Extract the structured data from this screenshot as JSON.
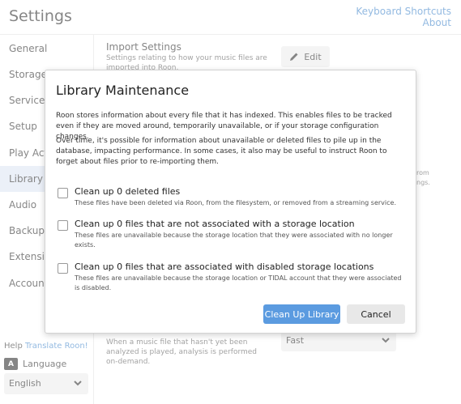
{
  "header": {
    "title": "Settings",
    "keyboard_shortcuts_label": "Keyboard Shortcuts",
    "about_label": "About"
  },
  "sidebar": {
    "items": [
      {
        "label": "General"
      },
      {
        "label": "Storage"
      },
      {
        "label": "Services"
      },
      {
        "label": "Setup"
      },
      {
        "label": "Play Actions"
      },
      {
        "label": "Library",
        "active": true
      },
      {
        "label": "Audio"
      },
      {
        "label": "Backups"
      },
      {
        "label": "Extensions"
      },
      {
        "label": "Account"
      }
    ],
    "help_prefix": "Help",
    "help_link": "Translate Roon!",
    "language_icon": "translate-icon",
    "language_icon_text": "A",
    "language_label": "Language",
    "language_value": "English"
  },
  "main": {
    "import_settings": {
      "title": "Import Settings",
      "description": "Settings relating to how your music files are imported into Roon.",
      "edit_label": "Edit"
    },
    "clipped_right": [
      "rom",
      "ngs."
    ],
    "analysis": {
      "description": "When a music file that hasn't yet been analyzed is played, analysis is performed on-demand.",
      "speed_value": "Fast"
    }
  },
  "dialog": {
    "title": "Library Maintenance",
    "paragraphs": [
      "Roon stores information about every file that it has indexed. This enables files to be tracked even if they are moved around, temporarily unavailable, or if your storage configuration changes.",
      "Over time, it's possible for information about unavailable or deleted files to pile up in the database, impacting performance. In some cases, it also may be useful to instruct Roon to forget about files prior to re-importing them."
    ],
    "options": [
      {
        "title": "Clean up 0 deleted files",
        "description": "These files have been deleted via Roon, from the filesystem, or removed from a streaming service.",
        "checked": false
      },
      {
        "title": "Clean up 0 files that are not associated with a storage location",
        "description": "These files are unavailable because the storage location that they were associated with no longer exists.",
        "checked": false
      },
      {
        "title": "Clean up 0 files that are associated with disabled storage locations",
        "description": "These files are unavailable because the storage location or TIDAL account that they were associated is disabled.",
        "checked": false
      }
    ],
    "primary_button": "Clean Up Library",
    "cancel_button": "Cancel"
  },
  "colors": {
    "accent": "#5b9be0",
    "link": "#3a80c8",
    "active_nav": "#dbe4f2",
    "button_gray": "#ebebeb"
  }
}
